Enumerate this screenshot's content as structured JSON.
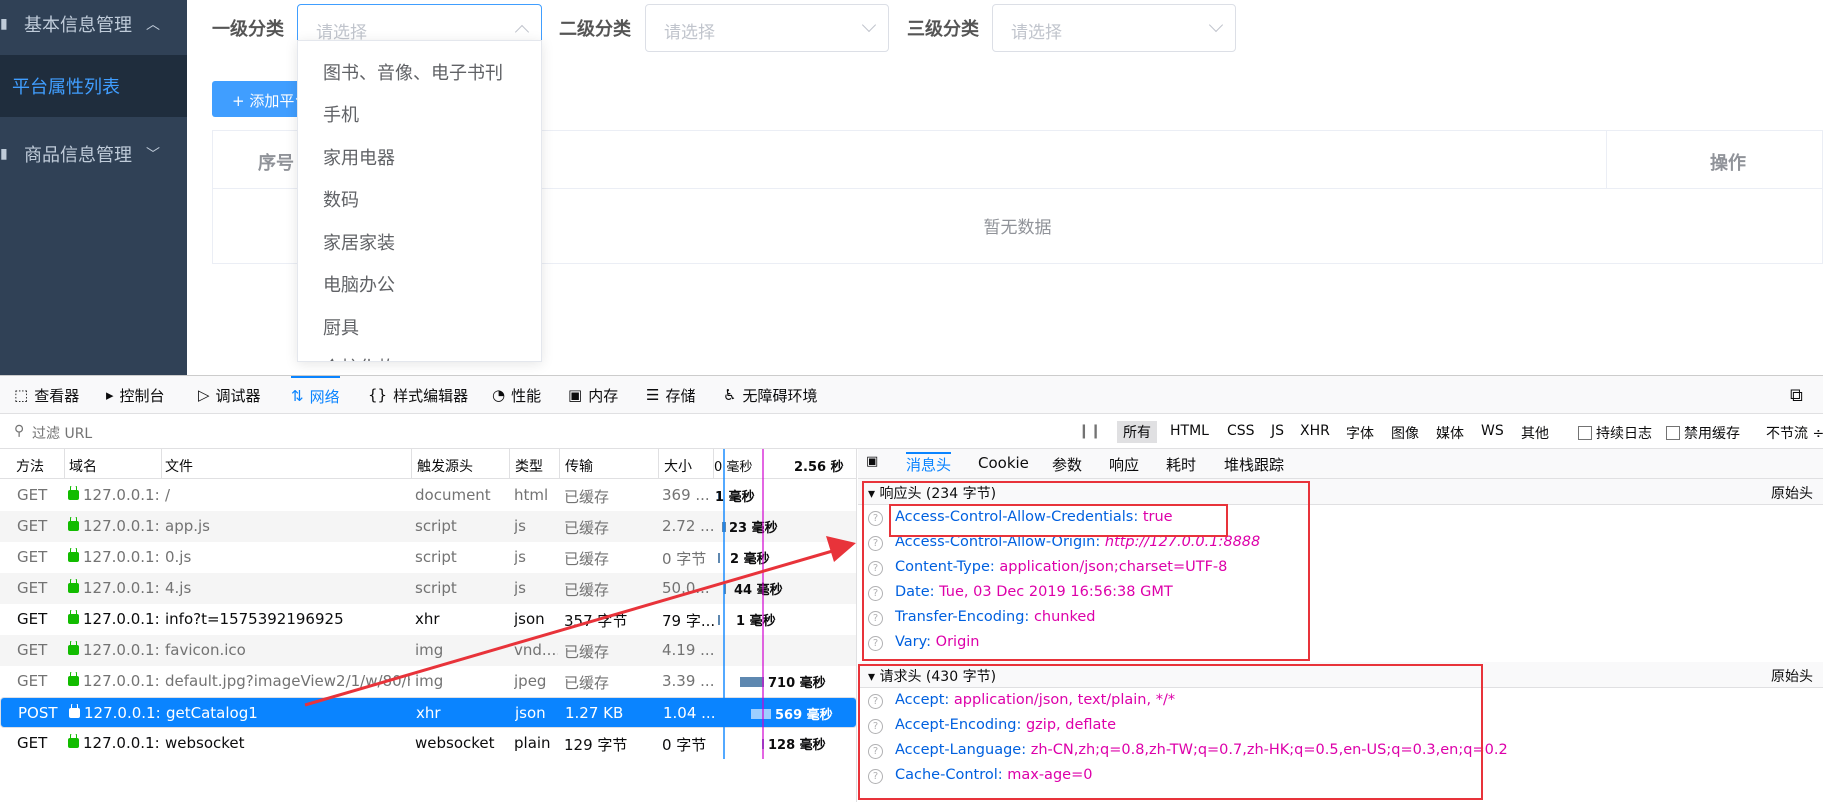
{
  "sidebar": {
    "menu1": "基本信息管理",
    "sub1": "平台属性列表",
    "menu2": "商品信息管理"
  },
  "filters": {
    "level1_label": "一级分类",
    "level2_label": "二级分类",
    "level3_label": "三级分类",
    "placeholder": "请选择"
  },
  "add_button": "+ 添加平台属性",
  "table": {
    "col_index": "序号",
    "col_action": "操作",
    "empty": "暂无数据"
  },
  "dropdown": {
    "options": [
      "图书、音像、电子书刊",
      "手机",
      "家用电器",
      "数码",
      "家居家装",
      "电脑办公",
      "厨具",
      "个护化妆"
    ]
  },
  "devtools": {
    "tabs": [
      {
        "icon": "inspector-icon",
        "glyph": "⬚",
        "label": "查看器"
      },
      {
        "icon": "console-icon",
        "glyph": "▸",
        "label": "控制台"
      },
      {
        "icon": "debugger-icon",
        "glyph": "▷",
        "label": "调试器"
      },
      {
        "icon": "network-icon",
        "glyph": "⇅",
        "label": "网络"
      },
      {
        "icon": "style-editor-icon",
        "glyph": "{}",
        "label": "样式编辑器"
      },
      {
        "icon": "performance-icon",
        "glyph": "◔",
        "label": "性能"
      },
      {
        "icon": "memory-icon",
        "glyph": "▣",
        "label": "内存"
      },
      {
        "icon": "storage-icon",
        "glyph": "☰",
        "label": "存储"
      },
      {
        "icon": "accessibility-icon",
        "glyph": "♿",
        "label": "无障碍环境"
      }
    ],
    "filter_placeholder": "过滤 URL",
    "filter_types": [
      "所有",
      "HTML",
      "CSS",
      "JS",
      "XHR",
      "字体",
      "图像",
      "媒体",
      "WS",
      "其他"
    ],
    "persist_log": "持续日志",
    "disable_cache": "禁用缓存",
    "throttle": "不节流 ÷",
    "columns": {
      "method": "方法",
      "domain": "域名",
      "file": "文件",
      "cause": "触发源头",
      "type": "类型",
      "transferred": "传输",
      "size": "大小",
      "wf_start": "0 毫秒",
      "wf_end": "2.56 秒"
    },
    "requests": [
      {
        "method": "GET",
        "domain": "127.0.0.1:...",
        "file": "/",
        "cause": "document",
        "type": "html",
        "transferred": "已缓存",
        "size": "369 ...",
        "time": "1 毫秒"
      },
      {
        "method": "GET",
        "domain": "127.0.0.1:...",
        "file": "app.js",
        "cause": "script",
        "type": "js",
        "transferred": "已缓存",
        "size": "2.72 ...",
        "time": "23 毫秒"
      },
      {
        "method": "GET",
        "domain": "127.0.0.1:...",
        "file": "0.js",
        "cause": "script",
        "type": "js",
        "transferred": "已缓存",
        "size": "0 字节",
        "time": "2 毫秒"
      },
      {
        "method": "GET",
        "domain": "127.0.0.1:...",
        "file": "4.js",
        "cause": "script",
        "type": "js",
        "transferred": "已缓存",
        "size": "50.0...",
        "time": "44 毫秒"
      },
      {
        "method": "GET",
        "domain": "127.0.0.1:...",
        "file": "info?t=1575392196925",
        "cause": "xhr",
        "type": "json",
        "transferred": "357 字节",
        "size": "79 字...",
        "time": "1 毫秒"
      },
      {
        "method": "GET",
        "domain": "127.0.0.1:...",
        "file": "favicon.ico",
        "cause": "img",
        "type": "vnd....",
        "transferred": "已缓存",
        "size": "4.19 ...",
        "time": ""
      },
      {
        "method": "GET",
        "domain": "127.0.0.1:...",
        "file": "default.jpg?imageView2/1/w/80/h/...",
        "cause": "img",
        "type": "jpeg",
        "transferred": "已缓存",
        "size": "3.39 ...",
        "time": "710 毫秒"
      },
      {
        "method": "POST",
        "domain": "127.0.0.1:...",
        "file": "getCatalog1",
        "cause": "xhr",
        "type": "json",
        "transferred": "1.27 KB",
        "size": "1.04 ...",
        "time": "569 毫秒"
      },
      {
        "method": "GET",
        "domain": "127.0.0.1:...",
        "file": "websocket",
        "cause": "websocket",
        "type": "plain",
        "transferred": "129 字节",
        "size": "0 字节",
        "time": "128 毫秒"
      }
    ],
    "detail_tabs": [
      "消息头",
      "Cookie",
      "参数",
      "响应",
      "耗时",
      "堆栈跟踪"
    ],
    "response_headers_title": "响应头 (234 字节)",
    "request_headers_title": "请求头 (430 字节)",
    "raw_headers": "原始头",
    "response_headers": [
      {
        "name": "Access-Control-Allow-Credentials:",
        "value": "true"
      },
      {
        "name": "Access-Control-Allow-Origin:",
        "value": "http://127.0.0.1:8888"
      },
      {
        "name": "Content-Type:",
        "value": "application/json;charset=UTF-8"
      },
      {
        "name": "Date:",
        "value": "Tue, 03 Dec 2019 16:56:38 GMT"
      },
      {
        "name": "Transfer-Encoding:",
        "value": "chunked"
      },
      {
        "name": "Vary:",
        "value": "Origin"
      }
    ],
    "request_headers": [
      {
        "name": "Accept:",
        "value": "application/json, text/plain, */*"
      },
      {
        "name": "Accept-Encoding:",
        "value": "gzip, deflate"
      },
      {
        "name": "Accept-Language:",
        "value": "zh-CN,zh;q=0.8,zh-TW;q=0.7,zh-HK;q=0.5,en-US;q=0.3,en;q=0.2"
      },
      {
        "name": "Cache-Control:",
        "value": "max-age=0"
      }
    ]
  }
}
